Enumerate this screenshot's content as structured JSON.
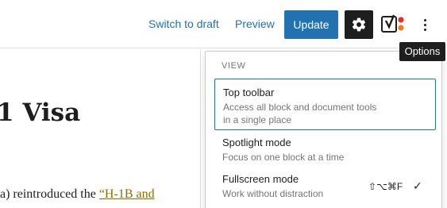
{
  "toolbar": {
    "switch_to_draft": "Switch to draft",
    "preview": "Preview",
    "update": "Update",
    "settings_icon": "gear-icon",
    "yoast_icon": "yoast-seo-icon",
    "more_icon": "vertical-ellipsis-icon"
  },
  "tooltip": {
    "text": "Options"
  },
  "editor": {
    "title_fragment": "1 Visa",
    "para_text": "a) reintroduced the ",
    "para_link": "“H-1B and"
  },
  "menu": {
    "section_label": "VIEW",
    "items": [
      {
        "title": "Top toolbar",
        "description_line1": "Access all block and document tools",
        "description_line2": "in a single place",
        "active": true
      },
      {
        "title": "Spotlight mode",
        "description_line1": "Focus on one block at a time"
      },
      {
        "title": "Fullscreen mode",
        "description_line1": "Work without distraction",
        "shortcut": "⇧⌥⌘F",
        "checked_mark": "✓"
      }
    ]
  },
  "colors": {
    "accent": "#2271b1",
    "dark": "#1e1e1e",
    "muted": "#757575",
    "link_gold": "#8a6d00"
  }
}
